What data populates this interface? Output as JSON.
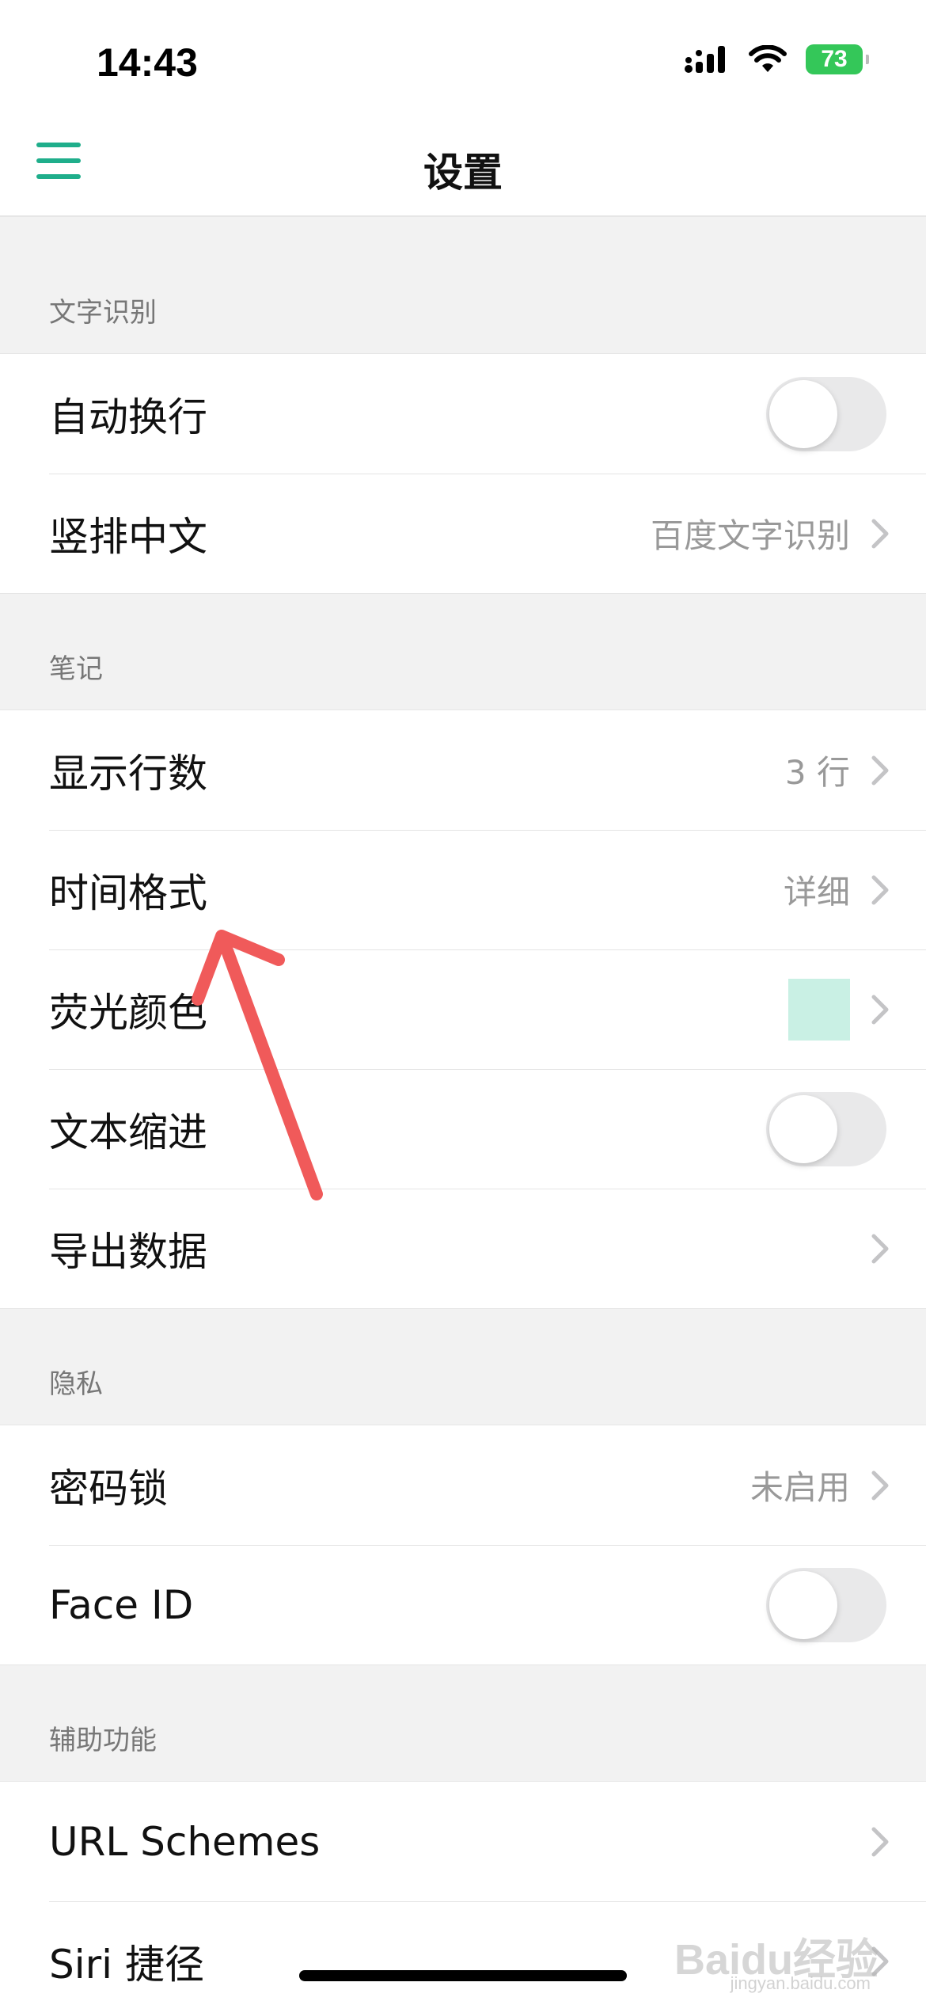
{
  "status_bar": {
    "time": "14:43",
    "battery": "73"
  },
  "nav": {
    "title": "设置"
  },
  "colors": {
    "accent": "#1fae8b",
    "highlight_swatch": "#c9f0e4",
    "annotation_arrow": "#f05a5a"
  },
  "sections": {
    "ocr": {
      "header": "文字识别",
      "auto_wrap": {
        "label": "自动换行",
        "toggle_on": false
      },
      "vertical_chinese": {
        "label": "竖排中文",
        "value": "百度文字识别"
      }
    },
    "notes": {
      "header": "笔记",
      "display_lines": {
        "label": "显示行数",
        "value": "3 行"
      },
      "time_format": {
        "label": "时间格式",
        "value": "详细"
      },
      "highlight_color": {
        "label": "荧光颜色"
      },
      "text_indent": {
        "label": "文本缩进",
        "toggle_on": false
      },
      "export_data": {
        "label": "导出数据"
      }
    },
    "privacy": {
      "header": "隐私",
      "passcode": {
        "label": "密码锁",
        "value": "未启用"
      },
      "face_id": {
        "label": "Face ID",
        "toggle_on": false
      }
    },
    "accessibility": {
      "header": "辅助功能",
      "url_schemes": {
        "label": "URL Schemes"
      },
      "siri": {
        "label": "Siri 捷径"
      }
    }
  },
  "watermark": {
    "brand": "Baidu经验",
    "url": "jingyan.baidu.com"
  }
}
